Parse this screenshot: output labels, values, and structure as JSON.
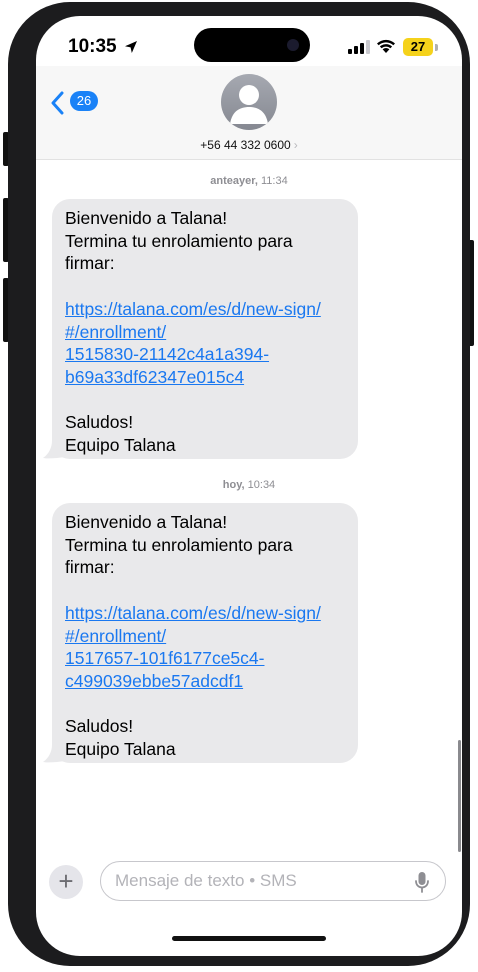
{
  "status_bar": {
    "time": "10:35",
    "battery": "27"
  },
  "header": {
    "back_badge": "26",
    "contact_number": "+56 44 332 0600",
    "contact_chevron": "›"
  },
  "messages": [
    {
      "timestamp_day": "anteayer,",
      "timestamp_time": " 11:34",
      "lines": [
        "Bienvenido a Talana!",
        "Termina tu enrolamiento para",
        "firmar:"
      ],
      "link_lines": [
        "https://talana.com/es/d/new-sign/",
        "#/enrollment/",
        "1515830-21142c4a1a394-",
        "b69a33df62347e015c4"
      ],
      "sign_off": [
        "Saludos!",
        "Equipo Talana"
      ]
    },
    {
      "timestamp_day": "hoy,",
      "timestamp_time": " 10:34",
      "lines": [
        "Bienvenido a Talana!",
        "Termina tu enrolamiento para",
        "firmar:"
      ],
      "link_lines": [
        "https://talana.com/es/d/new-sign/",
        "#/enrollment/",
        "1517657-101f6177ce5c4-",
        "c499039ebbe57adcdf1"
      ],
      "sign_off": [
        "Saludos!",
        "Equipo Talana"
      ]
    }
  ],
  "composer": {
    "plus_label": "+",
    "placeholder": "Mensaje de texto • SMS"
  },
  "icons": {
    "location": "location-arrow-icon",
    "signal": "cellular-signal-icon",
    "wifi": "wifi-icon",
    "back": "chevron-left-icon",
    "avatar": "person-icon",
    "mic": "microphone-icon"
  },
  "colors": {
    "accent": "#1a82f7",
    "link": "#1a78f0",
    "bubble": "#e9e9eb",
    "battery": "#f5d21b"
  }
}
